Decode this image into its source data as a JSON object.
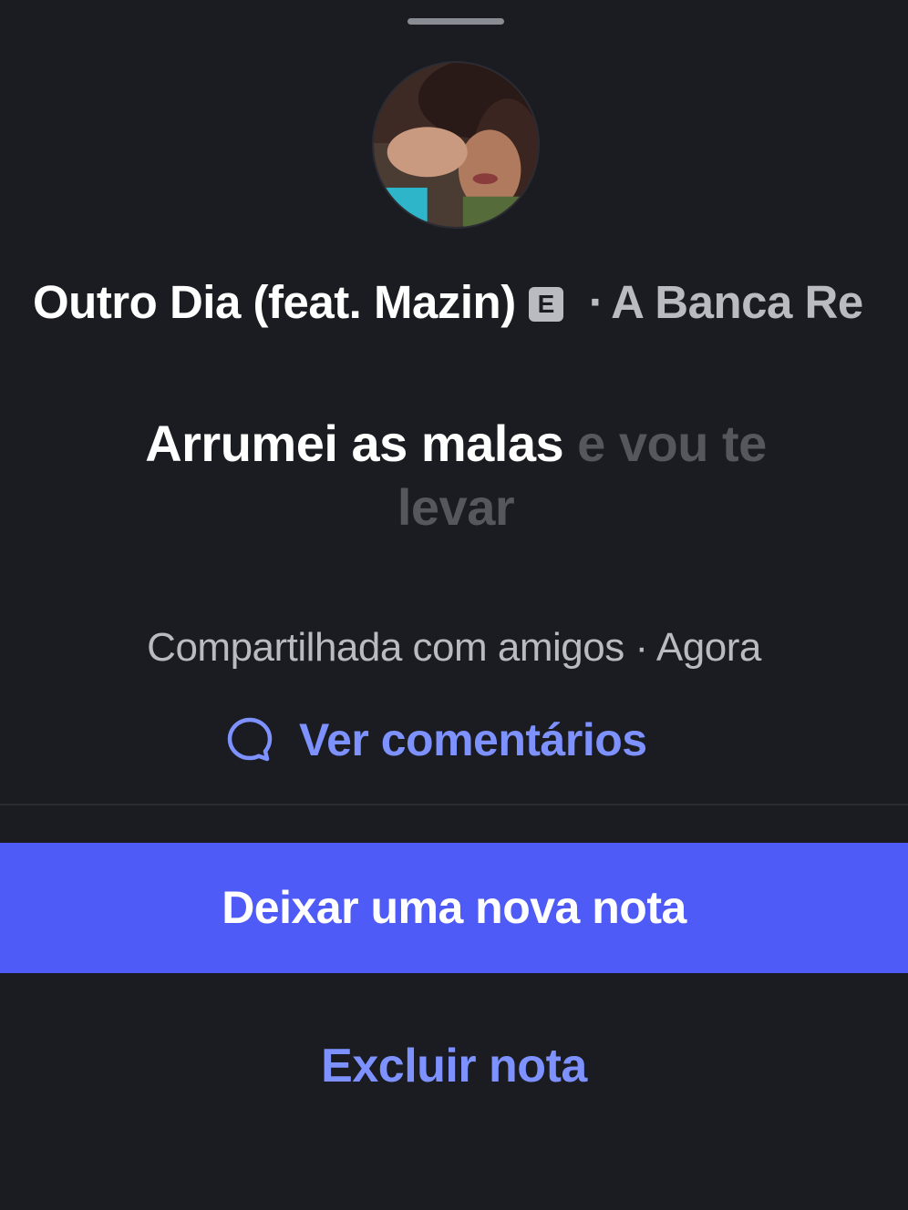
{
  "note": {
    "song_title": "Outro Dia (feat. Mazin)",
    "explicit_badge": "E",
    "separator": "·",
    "artist": "A Banca Re",
    "lyric_active": "Arrumei as malas",
    "lyric_rest": "e vou te levar",
    "shared_with": "Compartilhada com amigos · Agora"
  },
  "actions": {
    "comments_label": "Ver comentários",
    "new_note_label": "Deixar uma nova nota",
    "delete_label": "Excluir nota"
  },
  "colors": {
    "background": "#1b1c21",
    "accent": "#4f5bf7",
    "link": "#7e92ff",
    "text_primary": "#ffffff",
    "text_secondary": "#b9bbc0",
    "text_dim": "#55575d"
  },
  "icons": {
    "comments": "chat-bubble-icon",
    "avatar": "user-avatar"
  }
}
